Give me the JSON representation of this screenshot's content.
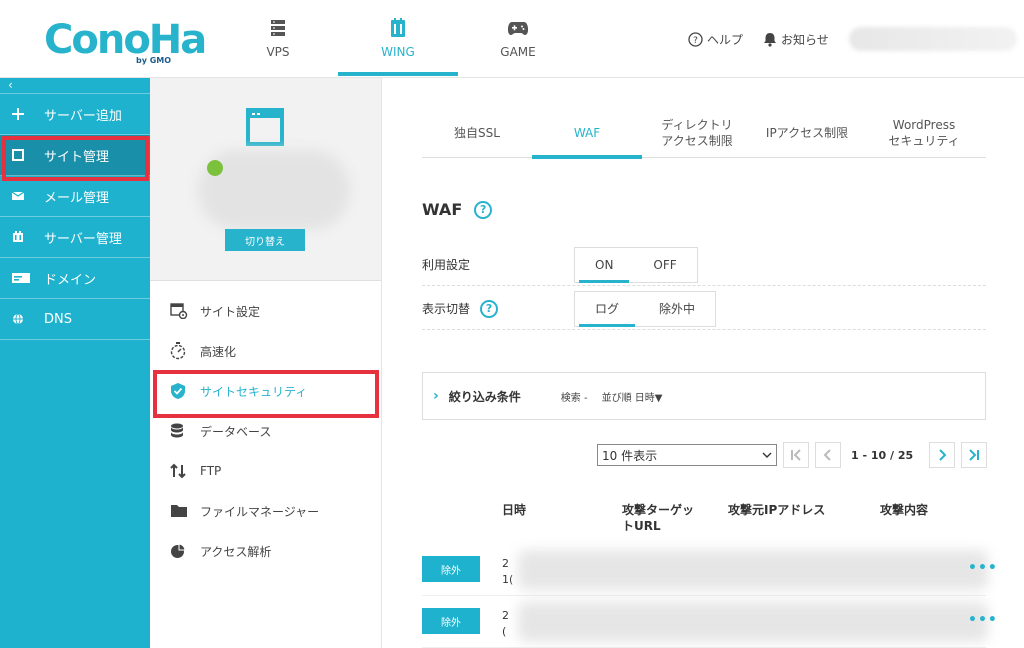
{
  "header": {
    "logo": "ConoHa",
    "logo_sub": "by GMO",
    "nav": [
      {
        "label": "VPS",
        "icon": "server-icon"
      },
      {
        "label": "WING",
        "icon": "wing-server-icon"
      },
      {
        "label": "GAME",
        "icon": "gamepad-icon"
      }
    ],
    "help_label": "ヘルプ",
    "notice_label": "お知らせ",
    "accent_color": "#27b3cc"
  },
  "sidebar": {
    "collapse": "‹",
    "items": [
      {
        "label": "サーバー追加",
        "icon": "plus-icon"
      },
      {
        "label": "サイト管理",
        "icon": "site-icon"
      },
      {
        "label": "メール管理",
        "icon": "mail-icon"
      },
      {
        "label": "サーバー管理",
        "icon": "server-manage-icon"
      },
      {
        "label": "ドメイン",
        "icon": "domain-icon"
      },
      {
        "label": "DNS",
        "icon": "globe-icon"
      }
    ],
    "color": "#1fb2ce"
  },
  "site_panel": {
    "switch_label": "切り替え",
    "menu": [
      {
        "label": "サイト設定",
        "icon": "site-settings-icon"
      },
      {
        "label": "高速化",
        "icon": "stopwatch-icon"
      },
      {
        "label": "サイトセキュリティ",
        "icon": "shield-icon"
      },
      {
        "label": "データベース",
        "icon": "database-icon"
      },
      {
        "label": "FTP",
        "icon": "transfer-icon"
      },
      {
        "label": "ファイルマネージャー",
        "icon": "folder-icon"
      },
      {
        "label": "アクセス解析",
        "icon": "pie-chart-icon"
      }
    ]
  },
  "content": {
    "tabs": [
      {
        "label": "独自SSL"
      },
      {
        "label": "WAF"
      },
      {
        "line1": "ディレクトリ",
        "line2": "アクセス制限"
      },
      {
        "label": "IPアクセス制限"
      },
      {
        "line1": "WordPress",
        "line2": "セキュリティ"
      }
    ],
    "title": "WAF",
    "help_mark": "?",
    "settings": {
      "usage_label": "利用設定",
      "usage_on": "ON",
      "usage_off": "OFF",
      "view_label": "表示切替",
      "view_log": "ログ",
      "view_excluded": "除外中"
    },
    "filter": {
      "chevron": "›",
      "label": "絞り込み条件",
      "search": "検索 -",
      "sort": "並び順  日時▼"
    },
    "pager": {
      "per_page": "10 件表示",
      "range": "1 - 10 / 25"
    },
    "table": {
      "headers": {
        "date": "日時",
        "target_line1": "攻撃ターゲッ",
        "target_line2": "トURL",
        "ip": "攻撃元IPアドレス",
        "content": "攻撃内容"
      },
      "rows": [
        {
          "action": "除外",
          "date_line1": "2",
          "date_line2": "1("
        },
        {
          "action": "除外",
          "date_line1": "2",
          "date_line2": "("
        }
      ],
      "more": "•••"
    }
  }
}
